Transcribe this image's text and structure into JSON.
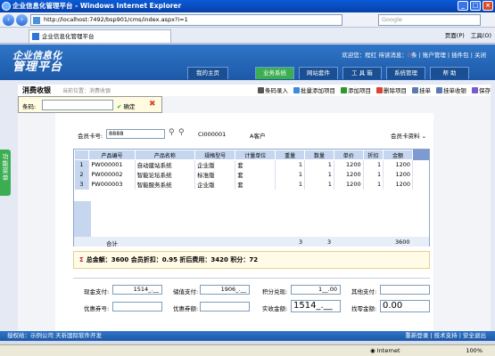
{
  "window": {
    "title": "企业信息化管理平台 - Windows Internet Explorer"
  },
  "browser": {
    "address": "http://localhost:7492/bsp901/cms/index.aspx?i=1",
    "search_placeholder": "Google",
    "tab_title": "企业信息化管理平台",
    "tools": {
      "page": "页面(P)",
      "tools": "工具(O)"
    }
  },
  "app": {
    "logo_line1": "企业信息化",
    "logo_line2": "管理平台",
    "top_links": {
      "welcome": "欢迎您：程红",
      "pending": "待读消息：",
      "pending_count": "0",
      "unit": "条",
      "account": "账户管理",
      "plugin": "插件包",
      "close": "关闭"
    },
    "nav_tabs": [
      "我的主页",
      "业务系统",
      "网站套件",
      "工 具 箱",
      "系统管理",
      "帮  助"
    ],
    "active_tab_index": 1
  },
  "toolbar": {
    "page_title": "消费收银",
    "crumb": "当前位置：消费收银",
    "buttons": [
      "条码录入",
      "批量添加项目",
      "添加项目",
      "删除项目",
      "挂单",
      "挂单收银",
      "保存"
    ]
  },
  "popup": {
    "label": "条码:",
    "ok": "确定"
  },
  "side_tab": "功能菜单",
  "customer": {
    "card_label": "会员卡号:",
    "card_value": "8888",
    "card_no": "CI000001",
    "name": "A客户",
    "info_link": "会员卡资料"
  },
  "table": {
    "columns": [
      "",
      "产品编号",
      "产品名称",
      "规格型号",
      "计量单位",
      "重量",
      "数量",
      "单价",
      "折扣",
      "金额"
    ],
    "rows": [
      {
        "idx": "1",
        "code": "PW000001",
        "name": "自动建站系统",
        "spec": "企业版",
        "unit": "套",
        "weight": "1",
        "qty": "1",
        "price": "1200",
        "discount": "1",
        "amount": "1200"
      },
      {
        "idx": "2",
        "code": "PW000002",
        "name": "智能论坛系统",
        "spec": "标准版",
        "unit": "套",
        "weight": "1",
        "qty": "1",
        "price": "1200",
        "discount": "1",
        "amount": "1200"
      },
      {
        "idx": "3",
        "code": "PW000003",
        "name": "智能服务系统",
        "spec": "企业版",
        "unit": "套",
        "weight": "1",
        "qty": "1",
        "price": "1200",
        "discount": "1",
        "amount": "1200"
      }
    ],
    "total_label": "合计",
    "total_weight": "3",
    "total_qty": "3",
    "total_amount": "3600"
  },
  "summary": {
    "symbol": "Σ",
    "text": "总金额：3600 会员折扣：0.95 折后费用：3420 积分：72"
  },
  "payment": {
    "cash_label": "现金支付:",
    "cash_value": "1514_.__",
    "stored_label": "储值支付:",
    "stored_value": "1906_.__",
    "points_label": "积分兑现:",
    "points_value": "1__.00",
    "other_label": "其他支付:",
    "other_value": "",
    "coupon_no_label": "优惠券号:",
    "coupon_no_value": "",
    "coupon_amt_label": "优惠券额:",
    "coupon_amt_value": "",
    "received_label": "实收金额:",
    "received_value": "1514_.__",
    "change_label": "找零金额:",
    "change_value": "0.00"
  },
  "footer": {
    "left": "授权给：示例公司  天祈国际软件开发",
    "right": "重新登录 | 技术支持 | 安全退出"
  },
  "status": {
    "zone": "Internet",
    "zoom": "100%"
  },
  "colors": {
    "header_blue": "#1d58a8",
    "active_green": "#3cae52",
    "grid_header": "#c6d6ef"
  }
}
